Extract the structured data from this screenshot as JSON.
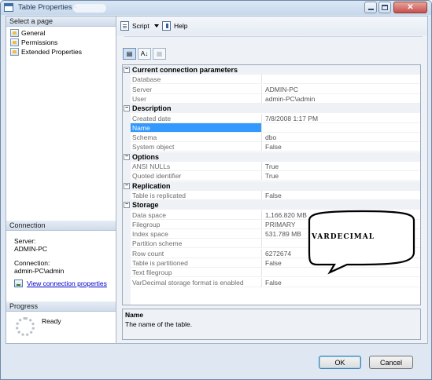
{
  "window": {
    "title": "Table Properties -"
  },
  "left_panel": {
    "select_page_header": "Select a page",
    "pages": [
      {
        "label": "General",
        "icon": "page-icon"
      },
      {
        "label": "Permissions",
        "icon": "page-icon"
      },
      {
        "label": "Extended Properties",
        "icon": "page-icon"
      }
    ],
    "connection": {
      "header": "Connection",
      "server_label": "Server:",
      "server_value": "ADMIN-PC",
      "connection_label": "Connection:",
      "connection_value": "admin-PC\\admin",
      "view_link": "View connection properties"
    },
    "progress": {
      "header": "Progress",
      "status": "Ready"
    }
  },
  "toolbar": {
    "script_label": "Script",
    "help_label": "Help"
  },
  "grid_tools": {
    "categorized_icon": "categorized-icon",
    "alphabetical_label": "A↓",
    "pages_icon": "property-pages-icon"
  },
  "property_grid": {
    "categories": [
      {
        "name": "Current connection parameters",
        "properties": [
          {
            "name": "Database",
            "value": ""
          },
          {
            "name": "Server",
            "value": "ADMIN-PC"
          },
          {
            "name": "User",
            "value": "admin-PC\\admin"
          }
        ]
      },
      {
        "name": "Description",
        "properties": [
          {
            "name": "Created date",
            "value": "7/8/2008 1:17 PM"
          },
          {
            "name": "Name",
            "value": "",
            "selected": true
          },
          {
            "name": "Schema",
            "value": "dbo"
          },
          {
            "name": "System object",
            "value": "False"
          }
        ]
      },
      {
        "name": "Options",
        "properties": [
          {
            "name": "ANSI NULLs",
            "value": "True"
          },
          {
            "name": "Quoted identifier",
            "value": "True"
          }
        ]
      },
      {
        "name": "Replication",
        "properties": [
          {
            "name": "Table is replicated",
            "value": "False"
          }
        ]
      },
      {
        "name": "Storage",
        "properties": [
          {
            "name": "Data space",
            "value": "1,166.820 MB"
          },
          {
            "name": "Filegroup",
            "value": "PRIMARY"
          },
          {
            "name": "Index space",
            "value": "531.789 MB"
          },
          {
            "name": "Partition scheme",
            "value": ""
          },
          {
            "name": "Row count",
            "value": "6272674"
          },
          {
            "name": "Table is partitioned",
            "value": "False"
          },
          {
            "name": "Text filegroup",
            "value": ""
          },
          {
            "name": "VarDecimal storage format is enabled",
            "value": "False"
          }
        ]
      }
    ]
  },
  "description": {
    "title": "Name",
    "text": "The name of the table."
  },
  "callout": {
    "text": "VARDECIMAL"
  },
  "buttons": {
    "ok": "OK",
    "cancel": "Cancel"
  },
  "colors": {
    "selection": "#3399ff",
    "link": "#0000cc",
    "window_bg": "#dfe8f2"
  }
}
